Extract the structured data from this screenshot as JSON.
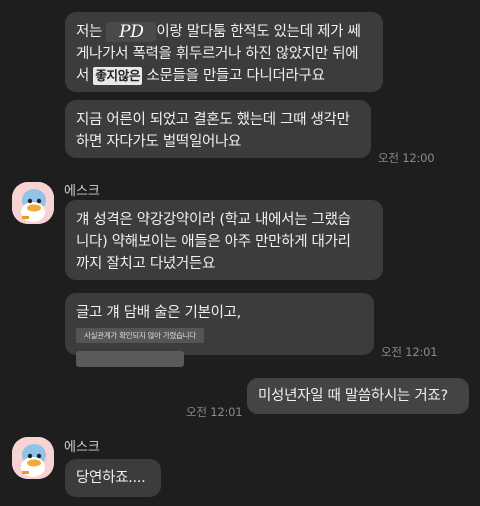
{
  "messages": {
    "m1": {
      "line1_pre": "저는 ",
      "masked_name": "PD",
      "line1_post": "이랑 말다툼 한적도 있는데 제가 쎄",
      "line2": "게나가서 폭력을 휘두르거나 하진 않았지만 뒤에",
      "line3_pre": "서 ",
      "stamp": "좋지않은",
      "line3_post": " 소문들을 만들고 다니더라구요"
    },
    "m2": {
      "line1": "지금 어른이 되었고 결혼도 했는데 그때 생각만",
      "line2": "하면 자다가도 벌떡일어나요",
      "time": "오전 12:00"
    },
    "sender1": "에스크",
    "m3": {
      "line1": "걔 성격은 약강강약이라 (학교 내에서는 그랬습",
      "line2": "니다) 약해보이는 애들은 아주 만만하게 대가리",
      "line3": "까지 잘치고 다녔거든요"
    },
    "m4": {
      "line1": "글고 걔 담배 술은 기본이고,",
      "note": "사실관계가 확인되지 않아 가렸습니다",
      "time": "오전 12:01"
    },
    "m5": {
      "text": "미성년자일 때 말씀하시는 거죠?",
      "time": "오전 12:01"
    },
    "sender2": "에스크",
    "m6": {
      "text": "당연하죠...."
    }
  }
}
